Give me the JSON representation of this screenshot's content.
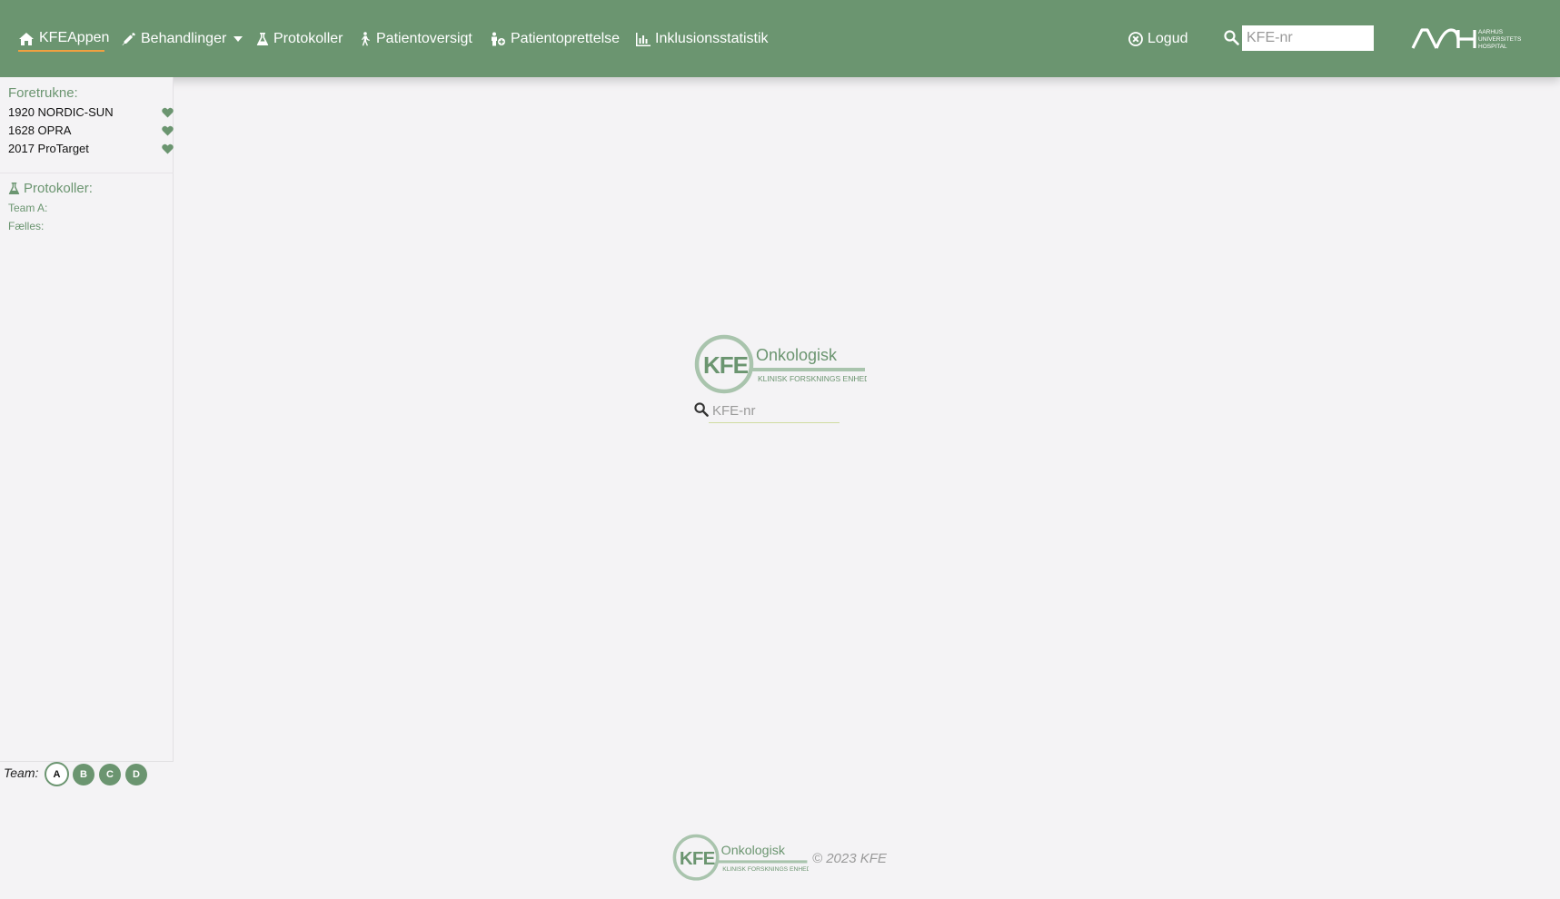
{
  "nav": {
    "home_label": "KFEAppen",
    "behandlinger_label": "Behandlinger",
    "protokoller_label": "Protokoller",
    "patientoversigt_label": "Patientoversigt",
    "patientoprettelse_label": "Patientoprettelse",
    "inklusionsstatistik_label": "Inklusionsstatistik",
    "logout_label": "Logud",
    "search_placeholder": "KFE-nr",
    "hospital_logo_text": [
      "AARHUS",
      "UNIVERSITETS",
      "HOSPITAL"
    ]
  },
  "sidebar": {
    "favorites_heading": "Foretrukne:",
    "favorites": [
      {
        "label": "1920 NORDIC-SUN"
      },
      {
        "label": "1628 OPRA"
      },
      {
        "label": "2017 ProTarget"
      }
    ],
    "protocols_heading": "Protokoller:",
    "protocol_groups": [
      {
        "label": "Team A:"
      },
      {
        "label": "Fælles:"
      }
    ]
  },
  "team_switcher": {
    "label": "Team:",
    "teams": [
      "A",
      "B",
      "C",
      "D"
    ],
    "active": "A"
  },
  "center": {
    "logo_main": "Onkologisk",
    "logo_sub": "KLINISK FORSKNINGS ENHED",
    "logo_mark": "KFE",
    "search_placeholder": "KFE-nr"
  },
  "footer": {
    "copyright": "© 2023 KFE"
  },
  "colors": {
    "brand_green": "#6b9570",
    "accent_orange": "#f0a040",
    "background": "#f4f3f5"
  }
}
